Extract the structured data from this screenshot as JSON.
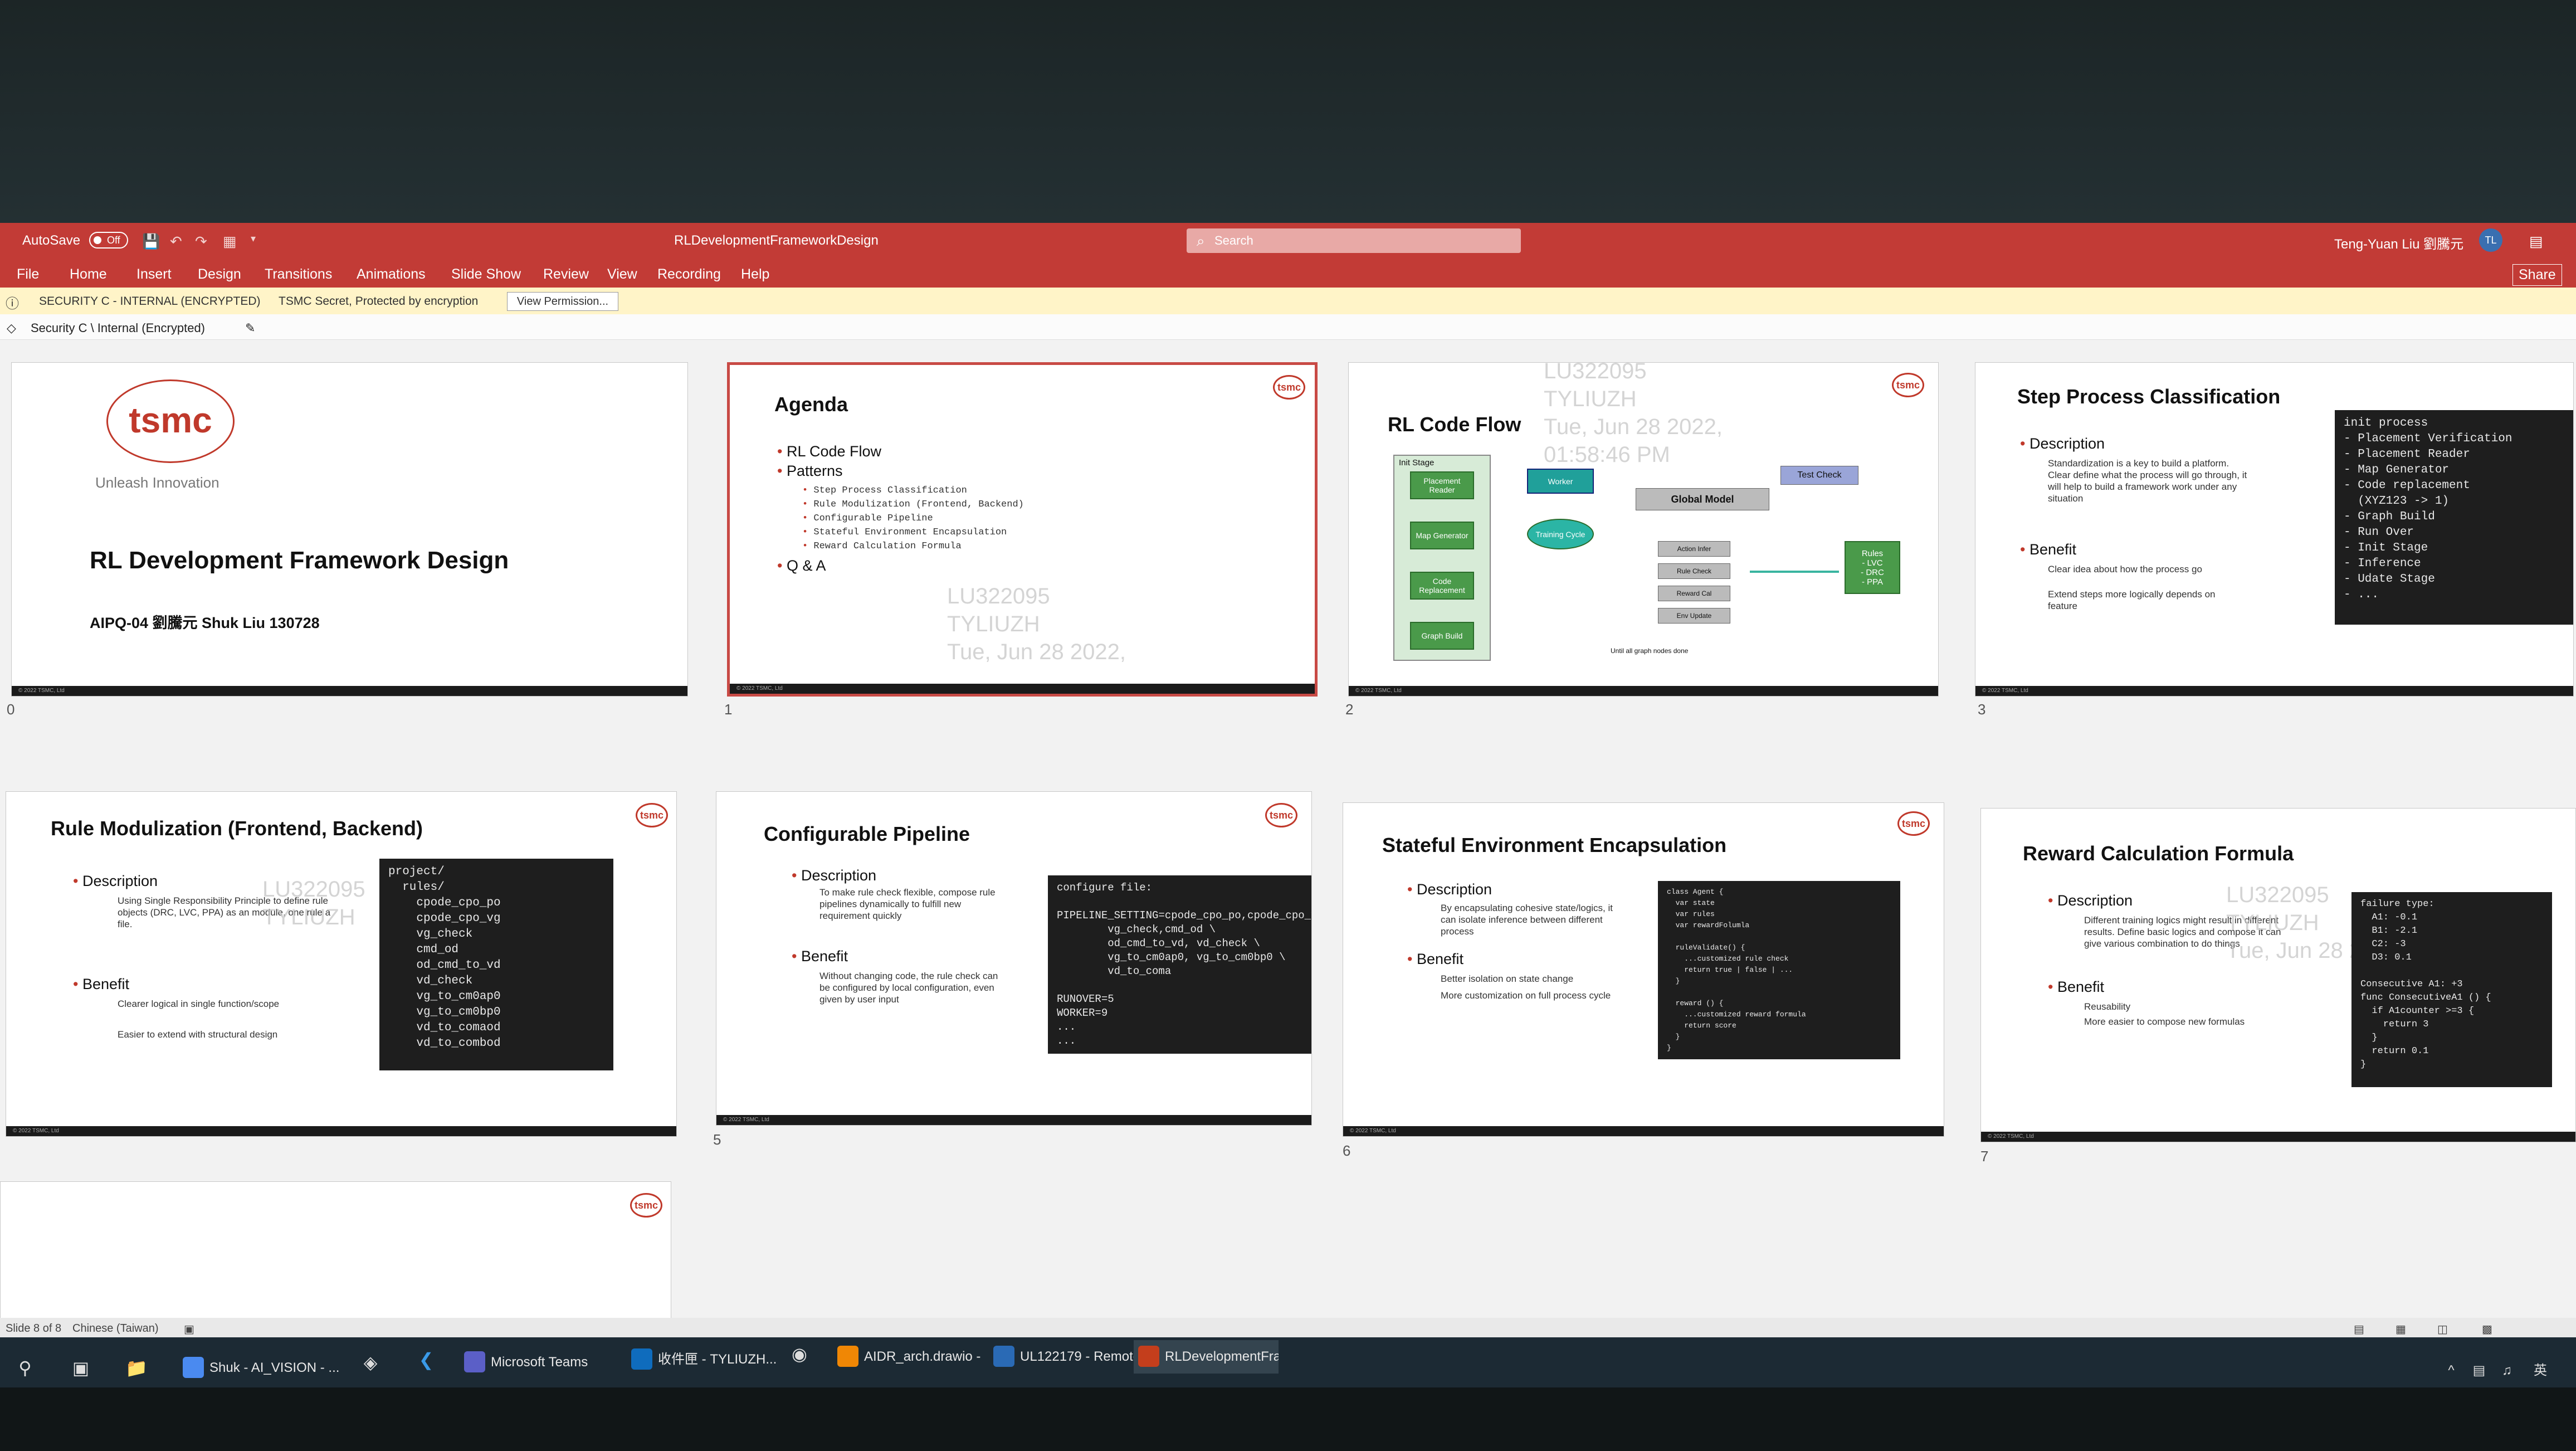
{
  "titlebar": {
    "autosave": "AutoSave",
    "autosave_state": "Off",
    "doc_title": "RLDevelopmentFrameworkDesign",
    "search_placeholder": "Search",
    "user_name": "Teng-Yuan Liu 劉騰元",
    "user_initials": "TL",
    "share": "Share"
  },
  "ribbon": {
    "tabs": [
      "File",
      "Home",
      "Insert",
      "Design",
      "Transitions",
      "Animations",
      "Slide Show",
      "Review",
      "View",
      "Recording",
      "Help"
    ]
  },
  "security_bar": {
    "label": "SECURITY C - INTERNAL (ENCRYPTED)",
    "message": "TSMC Secret, Protected by encryption",
    "button": "View Permission..."
  },
  "sensitivity": {
    "label": "Security C \\ Internal (Encrypted)"
  },
  "watermark": {
    "line1": "LU322095",
    "line2": "TYLIUZH",
    "line3": "Tue, Jun 28 2022,",
    "line4": "01:58:46 PM"
  },
  "slides": {
    "s0": {
      "num": "0",
      "logo": "tsmc",
      "tagline": "Unleash Innovation",
      "title": "RL Development Framework Design",
      "subtitle": "AIPQ-04 劉騰元 Shuk Liu 130728",
      "footer": "© 2022 TSMC, Ltd"
    },
    "s1": {
      "num": "1",
      "title": "Agenda",
      "items": [
        "RL Code Flow",
        "Patterns",
        "Step Process Classification",
        "Rule Modulization (Frontend, Backend)",
        "Configurable Pipeline",
        "Stateful Environment Encapsulation",
        "Reward Calculation Formula",
        "Q & A"
      ],
      "footer": "© 2022 TSMC, Ltd"
    },
    "s2": {
      "num": "2",
      "title": "RL Code Flow",
      "init_stage": "Init Stage",
      "boxes": [
        "Placement Reader",
        "Map Generator",
        "Code Replacement",
        "Graph Build"
      ],
      "worker": "Worker",
      "training": "Training Cycle",
      "global_model": "Global Model",
      "test_check": "Test Check",
      "actions": [
        "Action Infer",
        "Rule Check",
        "Reward Cal",
        "Env Update"
      ],
      "rules": "Rules\n- LVC\n- DRC\n- PPA",
      "loop_note": "Until all graph nodes done",
      "footer": "© 2022 TSMC, Ltd"
    },
    "s3": {
      "num": "3",
      "title": "Step Process Classification",
      "desc_h": "Description",
      "desc": "Standardization is a key to build a platform. Clear define what the process will go through, it will help to build a framework work under any situation",
      "ben_h": "Benefit",
      "ben1": "Clear idea about how the process go",
      "ben2": "Extend steps more logically depends on feature",
      "code": "init process\n- Placement Verification\n- Placement Reader\n- Map Generator\n- Code replacement\n  (XYZ123 -> 1)\n- Graph Build\n- Run Over\n- Init Stage\n- Inference\n- Udate Stage\n- ...",
      "footer": "© 2022 TSMC, Ltd"
    },
    "s4": {
      "num": "4",
      "title": "Rule Modulization (Frontend, Backend)",
      "desc_h": "Description",
      "desc": "Using Single Responsibility Principle to define rule objects (DRC, LVC, PPA) as an module, one rule a file.",
      "ben_h": "Benefit",
      "ben1": "Clearer logical in single function/scope",
      "ben2": "Easier to extend with structural design",
      "code": "project/\n  rules/\n    cpode_cpo_po\n    cpode_cpo_vg\n    vg_check\n    cmd_od\n    od_cmd_to_vd\n    vd_check\n    vg_to_cm0ap0\n    vg_to_cm0bp0\n    vd_to_comaod\n    vd_to_combod",
      "footer": "© 2022 TSMC, Ltd"
    },
    "s5": {
      "num": "5",
      "title": "Configurable Pipeline",
      "desc_h": "Description",
      "desc": "To make rule check flexible, compose rule pipelines dynamically to fulfill new requirement quickly",
      "ben_h": "Benefit",
      "ben1": "Without changing code, the rule check can be configured by local configuration, even given by user input",
      "code": "configure file:\n\nPIPELINE_SETTING=cpode_cpo_po,cpode_cpo_vg\n        vg_check,cmd_od \\\n        od_cmd_to_vd, vd_check \\\n        vg_to_cm0ap0, vg_to_cm0bp0 \\\n        vd_to_coma\n\nRUNOVER=5\nWORKER=9\n...\n...",
      "footer": "© 2022 TSMC, Ltd"
    },
    "s6": {
      "num": "6",
      "title": "Stateful Environment Encapsulation",
      "desc_h": "Description",
      "desc": "By encapsulating cohesive state/logics, it can isolate inference between different process",
      "ben_h": "Benefit",
      "ben1": "Better isolation on state change",
      "ben2": "More customization on full process cycle",
      "code": "class Agent {\n  var state\n  var rules\n  var rewardFolumla\n\n  ruleValidate() {\n    ...customized rule check\n    return true | false | ...\n  }\n\n  reward () {\n    ...customized reward formula\n    return score\n  }\n}",
      "footer": "© 2022 TSMC, Ltd"
    },
    "s7": {
      "num": "7",
      "title": "Reward Calculation Formula",
      "desc_h": "Description",
      "desc": "Different training logics might result in different results. Define basic logics and compose it can give various combination to do things",
      "ben_h": "Benefit",
      "ben1": "Reusability",
      "ben2": "More easier to compose new formulas",
      "code": "failure type:\n  A1: -0.1\n  B1: -2.1\n  C2: -3\n  D3: 0.1\n\nConsecutive A1: +3\nfunc ConsecutiveA1 () {\n  if A1counter >=3 {\n    return 3\n  }\n  return 0.1\n}",
      "footer": "© 2022 TSMC, Ltd"
    }
  },
  "statusbar": {
    "slide": "Slide 8 of 8",
    "language": "Chinese (Taiwan)"
  },
  "taskbar": {
    "items": [
      "Shuk - AI_VISION - ...",
      "Microsoft Teams",
      "收件匣 - TYLIUZH...",
      "AIDR_arch.drawio - ...",
      "UL122179 - Remote...",
      "RLDevelopmentFra..."
    ],
    "lang": "英"
  }
}
